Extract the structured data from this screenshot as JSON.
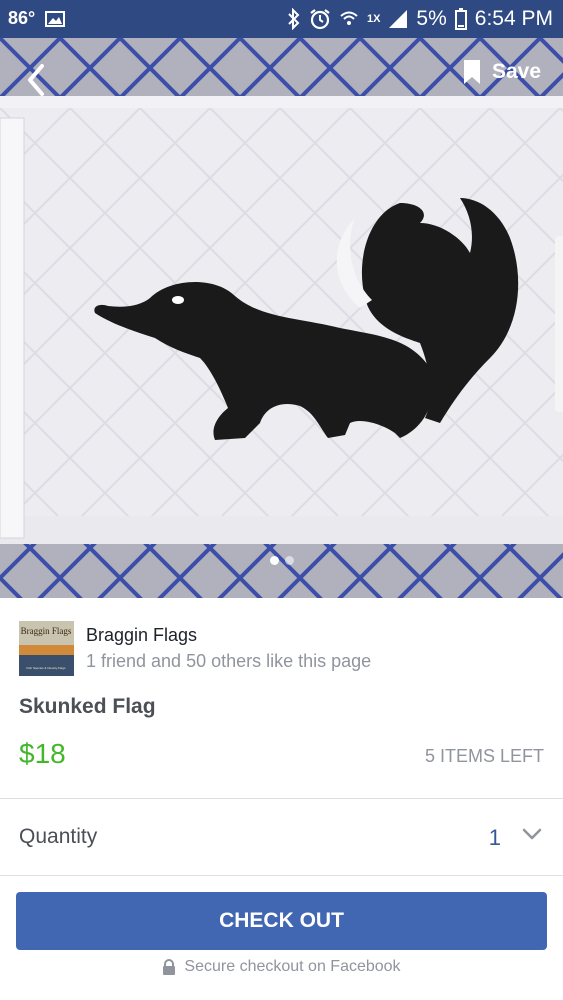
{
  "status_bar": {
    "temperature": "86°",
    "network_speed": "1X",
    "battery": "5%",
    "time": "6:54 PM"
  },
  "hero": {
    "save_label": "Save",
    "page_count": 2,
    "current_page": 1
  },
  "seller": {
    "logo_text": "Braggin Flags",
    "logo_subtext": "Fish Species & Novelty Flags",
    "name": "Braggin Flags",
    "likes": "1 friend and 50 others like this page"
  },
  "product": {
    "title": "Skunked Flag",
    "price": "$18",
    "stock": "5 ITEMS LEFT"
  },
  "quantity": {
    "label": "Quantity",
    "value": "1"
  },
  "checkout": {
    "button_label": "CHECK OUT",
    "secure_text": "Secure checkout on Facebook"
  },
  "colors": {
    "status_bar": "#2f4a82",
    "price": "#42b72a",
    "button": "#4267b2",
    "quantity_value": "#365899"
  }
}
